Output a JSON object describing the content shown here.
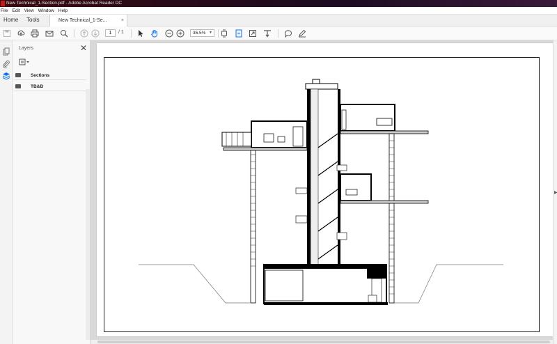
{
  "window": {
    "title": "New Technical_1-Section.pdf - Adobe Acrobat Reader DC"
  },
  "menu": [
    "File",
    "Edit",
    "View",
    "Window",
    "Help"
  ],
  "tabs": {
    "home": "Home",
    "tools": "Tools",
    "document": "New Technical_1-Se...",
    "close_glyph": "×"
  },
  "toolbar": {
    "page_current": "1",
    "page_total": "/ 1",
    "zoom": "36.5%",
    "icons": [
      "save-icon",
      "upload-icon",
      "print-icon",
      "email-icon",
      "search-icon",
      "page-up-icon",
      "page-down-icon",
      "select-cursor-icon",
      "hand-icon",
      "zoom-out-icon",
      "zoom-in-icon",
      "fit-page-icon",
      "fit-width-icon",
      "full-screen-icon",
      "scroll-mode-icon",
      "comment-icon",
      "sign-icon"
    ]
  },
  "layers_panel": {
    "title": "Layers",
    "close_glyph": "✕",
    "layers": [
      {
        "label": "Sections"
      },
      {
        "label": "TB&B"
      }
    ]
  },
  "colors": {
    "accent": "#1473e6",
    "titlebar": "#2a0a18",
    "pdf_red": "#c91818"
  }
}
